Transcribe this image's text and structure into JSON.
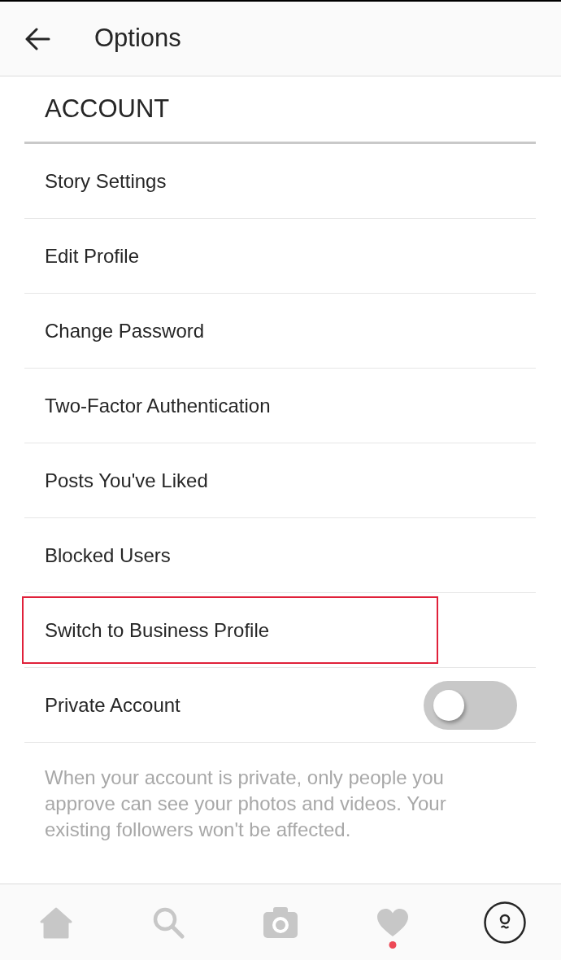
{
  "header": {
    "title": "Options"
  },
  "section": {
    "title": "ACCOUNT"
  },
  "items": [
    {
      "kind": "link",
      "label": "Story Settings",
      "highlighted": false
    },
    {
      "kind": "link",
      "label": "Edit Profile",
      "highlighted": false
    },
    {
      "kind": "link",
      "label": "Change Password",
      "highlighted": false
    },
    {
      "kind": "link",
      "label": "Two-Factor Authentication",
      "highlighted": false
    },
    {
      "kind": "link",
      "label": "Posts You've Liked",
      "highlighted": false
    },
    {
      "kind": "link",
      "label": "Blocked Users",
      "highlighted": false
    },
    {
      "kind": "link",
      "label": "Switch to Business Profile",
      "highlighted": true
    },
    {
      "kind": "toggle",
      "label": "Private Account",
      "on": false,
      "highlighted": false
    }
  ],
  "note": "When your account is private, only people you approve can see your photos and videos. Your existing followers won't be affected.",
  "tab_bar": {
    "tabs": [
      {
        "kind": "home",
        "selected": false,
        "notification": false
      },
      {
        "kind": "search",
        "selected": false,
        "notification": false
      },
      {
        "kind": "camera",
        "selected": false,
        "notification": false
      },
      {
        "kind": "activity",
        "selected": false,
        "notification": true
      },
      {
        "kind": "profile",
        "selected": true,
        "notification": false
      }
    ]
  }
}
